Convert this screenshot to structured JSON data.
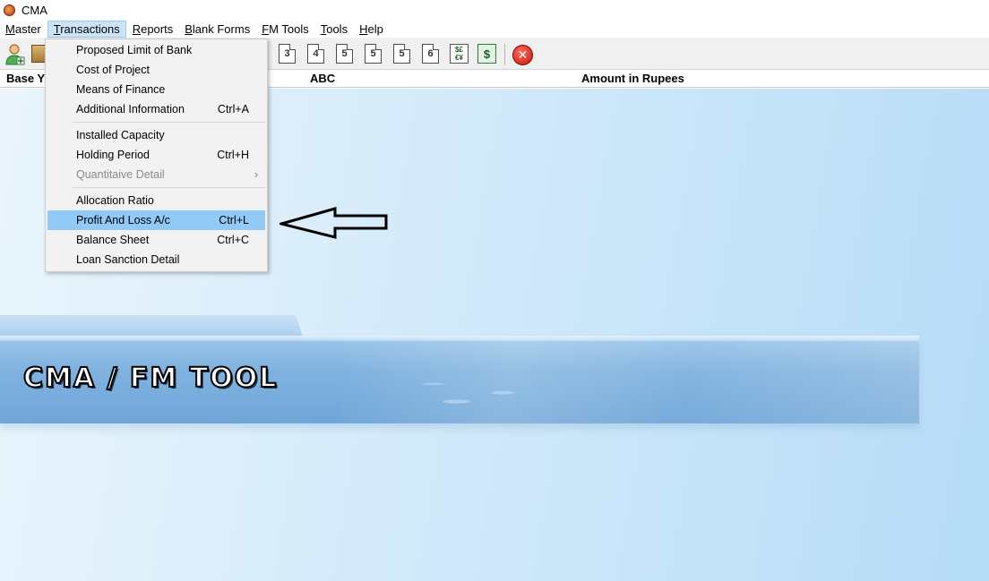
{
  "window": {
    "title": "CMA"
  },
  "menubar": [
    {
      "pre": "",
      "u": "M",
      "post": "aster"
    },
    {
      "pre": "",
      "u": "T",
      "post": "ransactions"
    },
    {
      "pre": "",
      "u": "R",
      "post": "eports"
    },
    {
      "pre": "",
      "u": "B",
      "post": "lank Forms"
    },
    {
      "pre": "",
      "u": "F",
      "post": "M Tools"
    },
    {
      "pre": "",
      "u": "T",
      "post": "ools"
    },
    {
      "pre": "",
      "u": "H",
      "post": "elp"
    }
  ],
  "toolbar": {
    "doc_numbers": [
      "3",
      "4",
      "5",
      "5",
      "5",
      "6"
    ],
    "currency_symbols": "$£\n€¥",
    "dollar": "$",
    "close": "✕"
  },
  "header": {
    "col1": "Base Y",
    "col2": "ABC",
    "col3": "Amount in Rupees"
  },
  "dropdown": {
    "items": [
      {
        "label": "Proposed Limit of Bank",
        "shortcut": ""
      },
      {
        "label": "Cost of Project",
        "shortcut": ""
      },
      {
        "label": "Means of Finance",
        "shortcut": ""
      },
      {
        "label": "Additional Information",
        "shortcut": "Ctrl+A"
      },
      {
        "label": "Installed Capacity",
        "shortcut": ""
      },
      {
        "label": "Holding Period",
        "shortcut": "Ctrl+H"
      },
      {
        "label": "Quantitaive Detail",
        "shortcut": "",
        "submenu": "›"
      },
      {
        "label": "Allocation Ratio",
        "shortcut": ""
      },
      {
        "label": "Profit And Loss A/c",
        "shortcut": "Ctrl+L"
      },
      {
        "label": "Balance Sheet",
        "shortcut": "Ctrl+C"
      },
      {
        "label": "Loan Sanction Detail",
        "shortcut": ""
      }
    ]
  },
  "banner": {
    "title": "CMA / FM TOOL"
  },
  "colors": {
    "highlight": "#91c9f7",
    "menu_active": "#cce4f7",
    "banner": "#7fb2df",
    "close_red": "#c8160b"
  }
}
